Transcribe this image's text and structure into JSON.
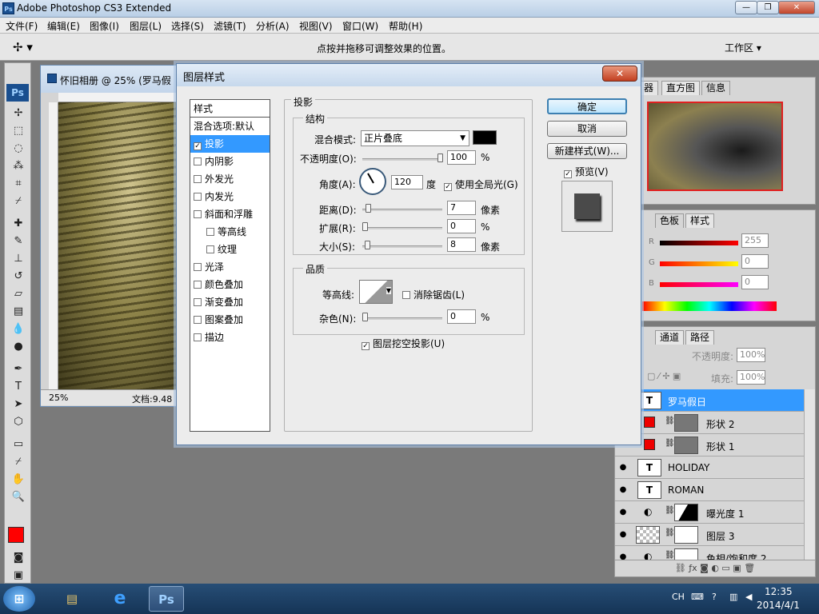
{
  "app": {
    "title": "Adobe Photoshop CS3 Extended",
    "icon": "Ps"
  },
  "menu": [
    "文件(F)",
    "编辑(E)",
    "图像(I)",
    "图层(L)",
    "选择(S)",
    "滤镜(T)",
    "分析(A)",
    "视图(V)",
    "窗口(W)",
    "帮助(H)"
  ],
  "options_bar": {
    "hint": "点按并拖移可调整效果的位置。",
    "workspace": "工作区 ▾"
  },
  "document": {
    "title": "怀旧相册 @ 25% (罗马假",
    "zoom": "25%",
    "status": "文档:9.48"
  },
  "dialog": {
    "title": "图层样式",
    "styles_header": "样式",
    "styles": [
      {
        "label": "混合选项:默认",
        "checkbox": false,
        "checked": false,
        "selected": false
      },
      {
        "label": "投影",
        "checkbox": true,
        "checked": true,
        "selected": true
      },
      {
        "label": "内阴影",
        "checkbox": true,
        "checked": false,
        "selected": false
      },
      {
        "label": "外发光",
        "checkbox": true,
        "checked": false,
        "selected": false
      },
      {
        "label": "内发光",
        "checkbox": true,
        "checked": false,
        "selected": false
      },
      {
        "label": "斜面和浮雕",
        "checkbox": true,
        "checked": false,
        "selected": false
      },
      {
        "label": "等高线",
        "checkbox": true,
        "checked": false,
        "selected": false,
        "indent": true
      },
      {
        "label": "纹理",
        "checkbox": true,
        "checked": false,
        "selected": false,
        "indent": true
      },
      {
        "label": "光泽",
        "checkbox": true,
        "checked": false,
        "selected": false
      },
      {
        "label": "颜色叠加",
        "checkbox": true,
        "checked": false,
        "selected": false
      },
      {
        "label": "渐变叠加",
        "checkbox": true,
        "checked": false,
        "selected": false
      },
      {
        "label": "图案叠加",
        "checkbox": true,
        "checked": false,
        "selected": false
      },
      {
        "label": "描边",
        "checkbox": true,
        "checked": false,
        "selected": false
      }
    ],
    "section_title": "投影",
    "structure": {
      "group_label": "结构",
      "blend_mode_label": "混合模式:",
      "blend_mode": "正片叠底",
      "shadow_color": "#000000",
      "opacity_label": "不透明度(O):",
      "opacity": "100",
      "percent": "%",
      "angle_label": "角度(A):",
      "angle": "120",
      "degree_unit": "度",
      "global_light_label": "使用全局光(G)",
      "distance_label": "距离(D):",
      "distance": "7",
      "spread_label": "扩展(R):",
      "spread": "0",
      "size_label": "大小(S):",
      "size": "8",
      "px_unit": "像素"
    },
    "quality": {
      "group_label": "品质",
      "contour_label": "等高线:",
      "anti_alias_label": "消除锯齿(L)",
      "noise_label": "杂色(N):",
      "noise": "0",
      "knockout_label": "图层挖空投影(U)"
    },
    "buttons": {
      "ok": "确定",
      "cancel": "取消",
      "new_style": "新建样式(W)...",
      "preview": "预览(V)"
    }
  },
  "navigator_panel": {
    "tabs": [
      "器",
      "直方图",
      "信息"
    ]
  },
  "color_panel": {
    "tabs": [
      "色板",
      "样式"
    ],
    "channels": [
      {
        "label": "R",
        "value": "255"
      },
      {
        "label": "G",
        "value": "0"
      },
      {
        "label": "B",
        "value": "0"
      }
    ]
  },
  "layers_panel": {
    "tabs": [
      "通道",
      "路径"
    ],
    "opacity_label": "不透明度:",
    "opacity": "100%",
    "fill_label": "填充:",
    "fill": "100%",
    "layers": [
      {
        "name": "罗马假日",
        "thumb": "T",
        "active": true,
        "eye": false
      },
      {
        "name": "形状 2",
        "thumb": "",
        "active": false,
        "eye": false,
        "shape": true
      },
      {
        "name": "形状 1",
        "thumb": "",
        "active": false,
        "eye": false,
        "shape": true
      },
      {
        "name": "HOLIDAY",
        "thumb": "T",
        "active": false,
        "eye": true
      },
      {
        "name": "ROMAN",
        "thumb": "T",
        "active": false,
        "eye": true
      },
      {
        "name": "曝光度 1",
        "thumb": "",
        "active": false,
        "eye": true,
        "adjust": true
      },
      {
        "name": "图层 3",
        "thumb": "",
        "active": false,
        "eye": true,
        "adjust": true
      },
      {
        "name": "色相/饱和度 2",
        "thumb": "",
        "active": false,
        "eye": true,
        "adjust": true
      }
    ]
  },
  "taskbar": {
    "time": "12:35",
    "date": "2014/4/1",
    "lang": "CH"
  },
  "colors": {
    "selection": "#3399ff",
    "foreground": "#ff0000"
  }
}
